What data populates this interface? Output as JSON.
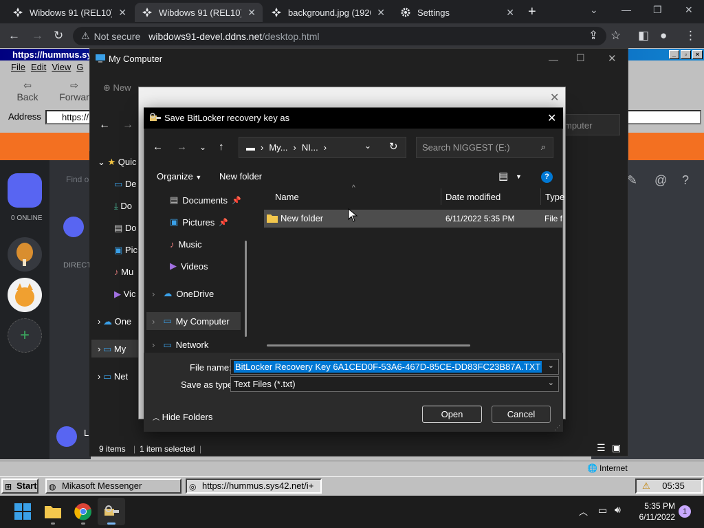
{
  "browser": {
    "tabs": [
      {
        "title": "Wibdows 91 (REL10)",
        "close": "✕"
      },
      {
        "title": "Wibdows 91 (REL10)",
        "close": "✕"
      },
      {
        "title": "background.jpg (1920×",
        "close": "✕"
      },
      {
        "title": "Settings",
        "close": "✕"
      }
    ],
    "new_tab": "+",
    "security_label": "Not secure",
    "url_host": "wibdows91-devel.ddns.net",
    "url_path": "/desktop.html"
  },
  "w98": {
    "title": "https://hummus.sys",
    "menu": [
      "File",
      "Edit",
      "View",
      "G"
    ],
    "toolbar": {
      "back": "Back",
      "forward": "Forwar"
    },
    "address_label": "Address",
    "address_value": "https://",
    "status_zone": "Internet",
    "taskbar": {
      "start": "Start",
      "tasks": [
        "Mikasoft Messenger",
        "https://hummus.sys42.net/i+"
      ],
      "clock": "05:35"
    }
  },
  "chat": {
    "online_label": "0 ONLINE",
    "find_placeholder": "Find o",
    "direct_label": "DIRECT",
    "user_initial": "L"
  },
  "explorer": {
    "title": "My Computer",
    "new_label": "New",
    "search_stub": "mputer",
    "nav": [
      "Quic",
      "De",
      "Do",
      "Do",
      "Pic",
      "Mu",
      "Vic",
      "One",
      "My",
      "Net"
    ],
    "status": {
      "items": "9 items",
      "selected": "1 item selected"
    }
  },
  "dialog": {
    "title": "Save BitLocker recovery key as",
    "breadcrumb": [
      "My...",
      "NI..."
    ],
    "search_placeholder": "Search NIGGEST (E:)",
    "organize": "Organize",
    "new_folder": "New folder",
    "help": "?",
    "sidebar": [
      {
        "label": "Documents",
        "pinned": true
      },
      {
        "label": "Pictures",
        "pinned": true
      },
      {
        "label": "Music",
        "pinned": false
      },
      {
        "label": "Videos",
        "pinned": false
      },
      {
        "label": "OneDrive",
        "pinned": false
      },
      {
        "label": "My Computer",
        "pinned": false
      },
      {
        "label": "Network",
        "pinned": false
      }
    ],
    "columns": {
      "name": "Name",
      "date": "Date modified",
      "type": "Type"
    },
    "rows": [
      {
        "name": "New folder",
        "date": "6/11/2022 5:35 PM",
        "type": "File fo"
      }
    ],
    "file_name_label": "File name:",
    "file_name_value": "BitLocker Recovery Key 6A1CED0F-53A6-467D-85CE-DD83FC23B87A.TXT",
    "save_type_label": "Save as type:",
    "save_type_value": "Text Files (*.txt)",
    "hide_folders": "Hide Folders",
    "open_button": "Open",
    "cancel_button": "Cancel"
  },
  "taskbar11": {
    "time": "5:35 PM",
    "date": "6/11/2022",
    "notifications": "1"
  },
  "colors": {
    "accent": "#0078d4",
    "orange_bar": "#f37021",
    "win98_title": "#000080"
  }
}
